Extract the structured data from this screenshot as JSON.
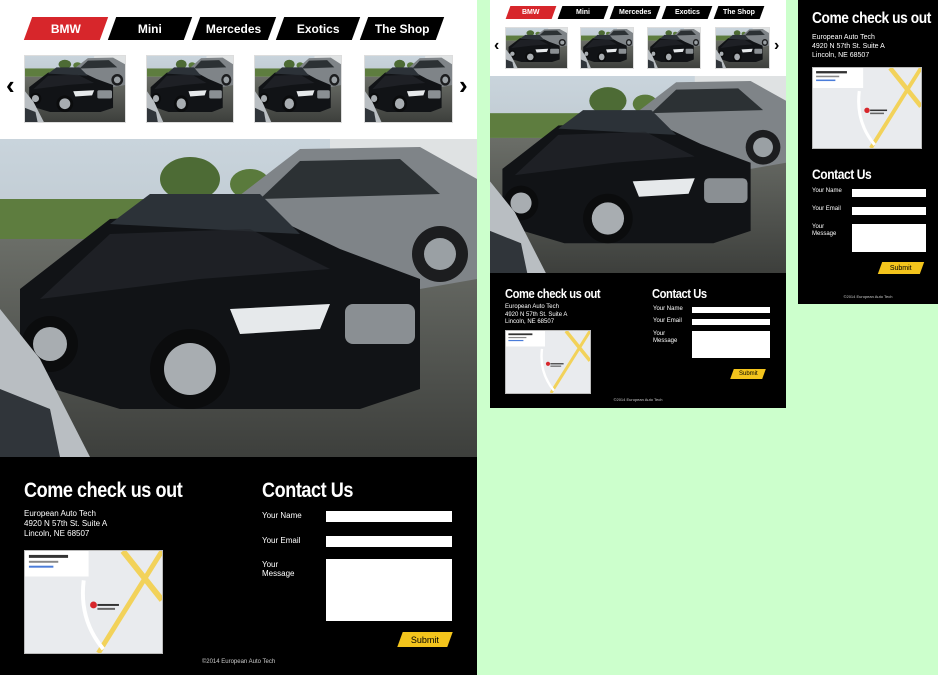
{
  "nav": {
    "tabs": [
      "BMW",
      "Mini",
      "Mercedes",
      "Exotics",
      "The Shop"
    ],
    "active_tab": "BMW"
  },
  "carousel": {
    "prev_icon": "chevron-left-icon",
    "next_icon": "chevron-right-icon",
    "prev_glyph": "‹",
    "next_glyph": "›"
  },
  "location": {
    "title": "Come check us out",
    "business": "European Auto Tech",
    "street": "4920 N 57th St. Suite A",
    "city": "Lincoln, NE 68507"
  },
  "contact": {
    "title": "Contact Us",
    "name_label": "Your Name",
    "email_label": "Your Email",
    "message_label": "Your Message",
    "submit_label": "Submit"
  },
  "footer": {
    "copyright": "©2014 European Auto Tech"
  },
  "colors": {
    "background": "#ccffcc",
    "active_tab": "#d7262b",
    "tab": "#000000",
    "submit": "#f3c41c",
    "footer": "#000000"
  }
}
